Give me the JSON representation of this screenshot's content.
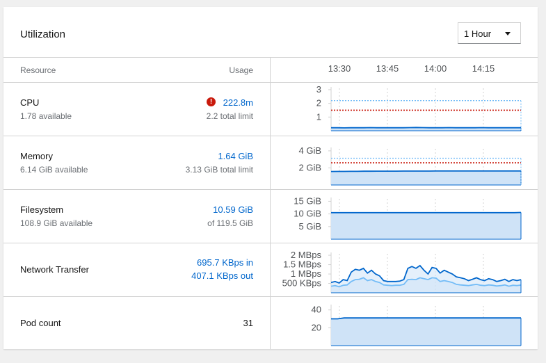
{
  "card": {
    "title": "Utilization",
    "time_range": {
      "selected": "1 Hour"
    }
  },
  "table": {
    "header": {
      "resource": "Resource",
      "usage": "Usage"
    },
    "time_ticks": [
      "13:30",
      "13:45",
      "14:00",
      "14:15"
    ],
    "rows": [
      {
        "name": "CPU",
        "available": "1.78 available",
        "usage": "222.8m",
        "limit": "2.2 total limit",
        "has_warning": true
      },
      {
        "name": "Memory",
        "available": "6.14 GiB available",
        "usage": "1.64 GiB",
        "limit": "3.13 GiB total limit"
      },
      {
        "name": "Filesystem",
        "available": "108.9 GiB available",
        "usage": "10.59 GiB",
        "limit": "of 119.5 GiB"
      },
      {
        "name": "Network Transfer",
        "usage_in": "695.7 KBps in",
        "usage_out": "407.1 KBps out"
      },
      {
        "name": "Pod count",
        "usage": "31"
      }
    ]
  },
  "colors": {
    "series_line": "#0066cc",
    "series_fill": "#cfe3f7",
    "secondary_line": "#73bcf7",
    "limit_line": "#c9190b",
    "request_line": "#73bcf7",
    "link": "#0066cc",
    "error": "#c9190b"
  },
  "chart_data": [
    {
      "name": "CPU",
      "type": "area",
      "y_ticks": [
        "3",
        "2",
        "1"
      ],
      "y_tick_values": [
        3,
        2,
        1
      ],
      "ylim": [
        0,
        3.2
      ],
      "series": [
        {
          "values": [
            0.22,
            0.22,
            0.21,
            0.22,
            0.22,
            0.22,
            0.23,
            0.22,
            0.22,
            0.22,
            0.22,
            0.22,
            0.23,
            0.24,
            0.23,
            0.22,
            0.22,
            0.22,
            0.23,
            0.22,
            0.22,
            0.22,
            0.22,
            0.23,
            0.22,
            0.22,
            0.22,
            0.22,
            0.22,
            0.22
          ]
        }
      ],
      "limit": 1.5,
      "request": 2.2
    },
    {
      "name": "Memory",
      "type": "area",
      "y_ticks": [
        "4 GiB",
        "2 GiB"
      ],
      "y_tick_values": [
        4,
        2
      ],
      "ylim": [
        0,
        4.4
      ],
      "series": [
        {
          "values": [
            1.58,
            1.59,
            1.59,
            1.6,
            1.6,
            1.61,
            1.61,
            1.62,
            1.62,
            1.62,
            1.62,
            1.63,
            1.63,
            1.63,
            1.63,
            1.63,
            1.64,
            1.64,
            1.64,
            1.64,
            1.64,
            1.64,
            1.64,
            1.64,
            1.64,
            1.64,
            1.64,
            1.64,
            1.64,
            1.64
          ]
        }
      ],
      "limit": 2.6,
      "request": 3.13
    },
    {
      "name": "Filesystem",
      "type": "area",
      "y_ticks": [
        "15 GiB",
        "10 GiB",
        "5 GiB"
      ],
      "y_tick_values": [
        15,
        10,
        5
      ],
      "ylim": [
        0,
        16.5
      ],
      "series": [
        {
          "values": [
            10.5,
            10.5,
            10.5,
            10.5,
            10.5,
            10.5,
            10.5,
            10.5,
            10.5,
            10.5,
            10.5,
            10.5,
            10.5,
            10.5,
            10.5,
            10.5,
            10.5,
            10.5,
            10.5,
            10.5,
            10.5,
            10.5,
            10.5,
            10.5,
            10.5,
            10.5,
            10.5,
            10.5,
            10.5,
            10.59
          ]
        }
      ]
    },
    {
      "name": "Network Transfer",
      "type": "area",
      "y_ticks": [
        "2 MBps",
        "1.5 MBps",
        "1 MBps",
        "500 KBps"
      ],
      "y_tick_values": [
        2,
        1.5,
        1,
        0.5
      ],
      "ylim": [
        0,
        2.15
      ],
      "series": [
        {
          "name": "in",
          "values": [
            0.55,
            0.6,
            0.52,
            0.7,
            0.65,
            1.1,
            1.25,
            1.2,
            1.3,
            1.05,
            1.2,
            1.0,
            0.9,
            0.65,
            0.6,
            0.6,
            0.6,
            0.62,
            0.7,
            1.3,
            1.4,
            1.3,
            1.45,
            1.2,
            1.0,
            1.35,
            1.3,
            1.05,
            1.2,
            1.1,
            1.0,
            0.85,
            0.8,
            0.75,
            0.65,
            0.72,
            0.8,
            0.7,
            0.65,
            0.75,
            0.7,
            0.6,
            0.65,
            0.72,
            0.6,
            0.7,
            0.65,
            0.7
          ]
        },
        {
          "name": "out",
          "values": [
            0.35,
            0.38,
            0.32,
            0.4,
            0.42,
            0.6,
            0.7,
            0.72,
            0.8,
            0.65,
            0.7,
            0.6,
            0.55,
            0.42,
            0.4,
            0.38,
            0.4,
            0.4,
            0.45,
            0.7,
            0.72,
            0.7,
            0.8,
            0.75,
            0.7,
            0.8,
            0.78,
            0.6,
            0.65,
            0.6,
            0.55,
            0.45,
            0.42,
            0.4,
            0.38,
            0.42,
            0.45,
            0.4,
            0.38,
            0.42,
            0.4,
            0.36,
            0.38,
            0.42,
            0.35,
            0.4,
            0.38,
            0.41
          ]
        }
      ]
    },
    {
      "name": "Pod count",
      "type": "area",
      "y_ticks": [
        "40",
        "20"
      ],
      "y_tick_values": [
        40,
        20
      ],
      "ylim": [
        0,
        46
      ],
      "series": [
        {
          "values": [
            30,
            30,
            31,
            31,
            31,
            31,
            31,
            31,
            31,
            31,
            31,
            31,
            31,
            31,
            31,
            31,
            31,
            31,
            31,
            31,
            31,
            31,
            31,
            31,
            31,
            31,
            31,
            31,
            31,
            31
          ]
        }
      ]
    }
  ]
}
